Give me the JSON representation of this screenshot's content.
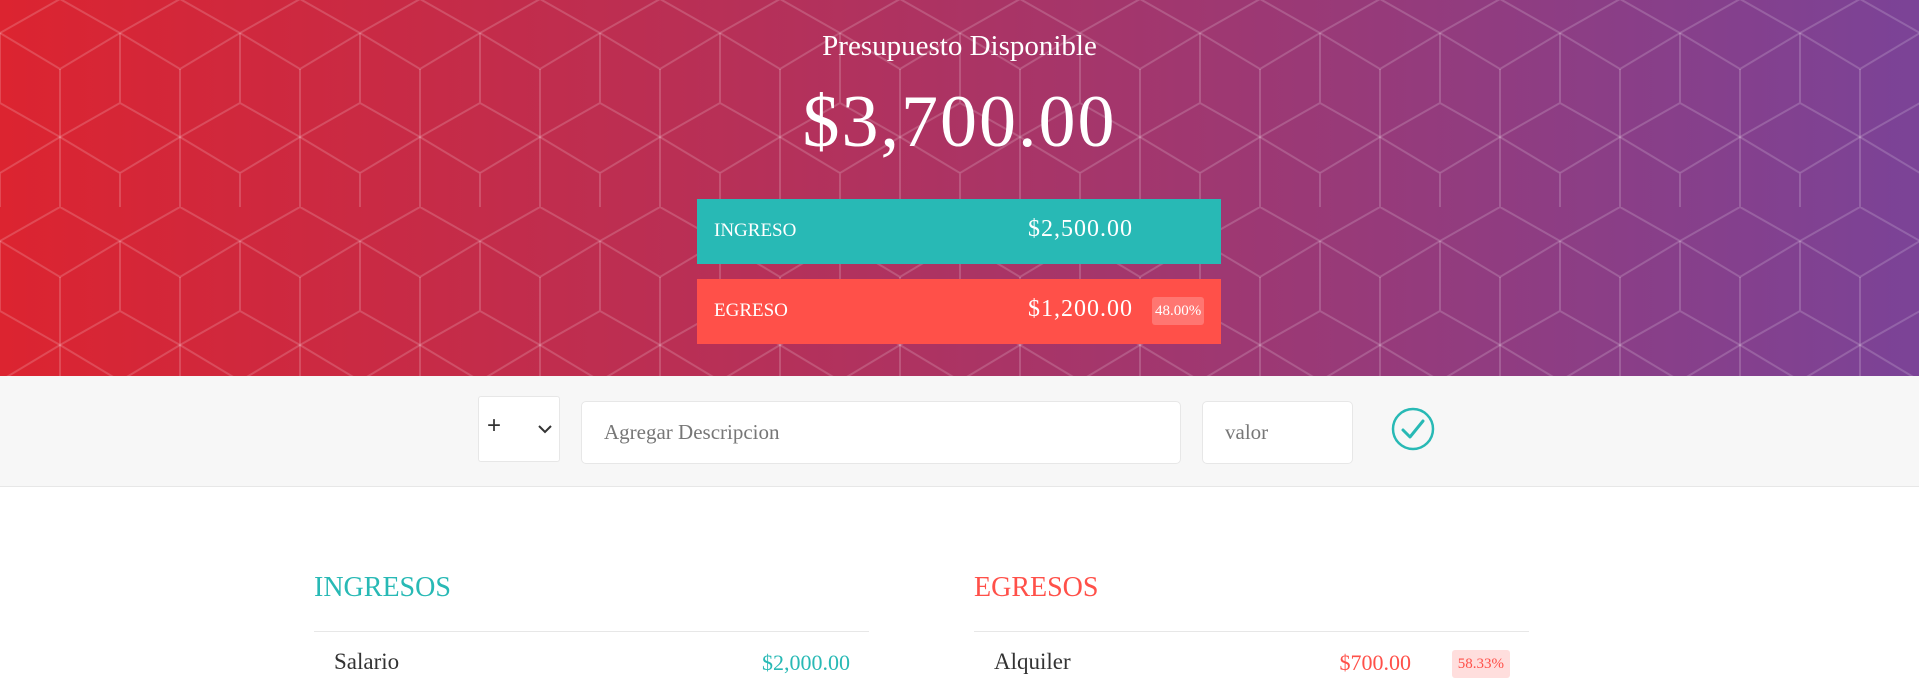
{
  "header": {
    "title": "Presupuesto Disponible",
    "available_budget": "$3,700.00",
    "income_label": "INGRESO",
    "income_total": "$2,500.00",
    "expense_label": "EGRESO",
    "expense_total": "$1,200.00",
    "expense_percentage": "48.00%"
  },
  "form": {
    "type_selected": "+",
    "description_placeholder": "Agregar Descripcion",
    "value_placeholder": "valor"
  },
  "incomes": {
    "title": "INGRESOS",
    "items": [
      {
        "description": "Salario",
        "value": "$2,000.00"
      }
    ]
  },
  "expenses": {
    "title": "EGRESOS",
    "items": [
      {
        "description": "Alquiler",
        "value": "$700.00",
        "percentage": "58.33%"
      }
    ]
  },
  "colors": {
    "income": "#28b9b5",
    "expense": "#ff5049",
    "gradient_start": "#dc2430",
    "gradient_end": "#7b4397"
  }
}
